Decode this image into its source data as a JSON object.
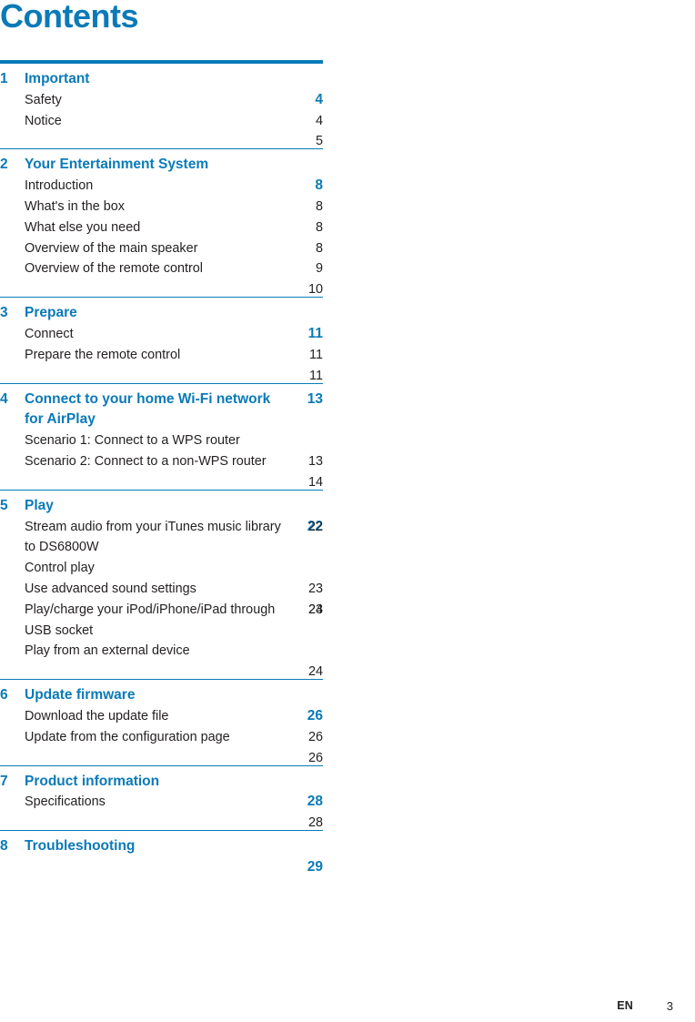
{
  "document": {
    "title": "Contents",
    "accent_color": "#0a7ab8",
    "text_color": "#231f20"
  },
  "footer": {
    "language": "EN",
    "page_number": "3"
  },
  "toc": {
    "sections": [
      {
        "number": "1",
        "title": "Important",
        "page": "4",
        "entries": [
          {
            "label": "Safety",
            "page": "4",
            "wraps": false
          },
          {
            "label": "Notice",
            "page": "5",
            "wraps": false
          }
        ]
      },
      {
        "number": "2",
        "title": "Your Entertainment System",
        "page": "8",
        "entries": [
          {
            "label": "Introduction",
            "page": "8",
            "wraps": false
          },
          {
            "label": "What's in the box",
            "page": "8",
            "wraps": false
          },
          {
            "label": "What else you need",
            "page": "8",
            "wraps": false
          },
          {
            "label": "Overview of the main speaker",
            "page": "9",
            "wraps": false
          },
          {
            "label": "Overview of the remote control",
            "page": "10",
            "wraps": false
          }
        ]
      },
      {
        "number": "3",
        "title": "Prepare",
        "page": "11",
        "entries": [
          {
            "label": "Connect",
            "page": "11",
            "wraps": false
          },
          {
            "label": "Prepare the remote control",
            "page": "11",
            "wraps": false
          }
        ]
      },
      {
        "number": "4",
        "title": "Connect to your home Wi-Fi network for AirPlay",
        "page": "13",
        "title_wraps": true,
        "entries": [
          {
            "label": "Scenario 1: Connect to a WPS router",
            "page": "13",
            "wraps": false
          },
          {
            "label": "Scenario 2: Connect to a non-WPS router",
            "page": "14",
            "wraps": false
          }
        ]
      },
      {
        "number": "5",
        "title": "Play",
        "page": "22",
        "entries": [
          {
            "label": "Stream audio from your iTunes music library to DS6800W",
            "page": "22",
            "wraps": true
          },
          {
            "label": "Control play",
            "page": "23",
            "wraps": false
          },
          {
            "label": "Use advanced sound settings",
            "page": "23",
            "wraps": false
          },
          {
            "label": "Play/charge your iPod/iPhone/iPad through USB socket",
            "page": "24",
            "wraps": true
          },
          {
            "label": "Play from an external device",
            "page": "24",
            "wraps": false
          }
        ]
      },
      {
        "number": "6",
        "title": "Update firmware",
        "page": "26",
        "entries": [
          {
            "label": "Download the update file",
            "page": "26",
            "wraps": false
          },
          {
            "label": "Update from the configuration page",
            "page": "26",
            "wraps": false
          }
        ]
      },
      {
        "number": "7",
        "title": "Product information",
        "page": "28",
        "entries": [
          {
            "label": "Specifications",
            "page": "28",
            "wraps": false
          }
        ]
      },
      {
        "number": "8",
        "title": "Troubleshooting",
        "page": "29",
        "entries": []
      }
    ]
  }
}
